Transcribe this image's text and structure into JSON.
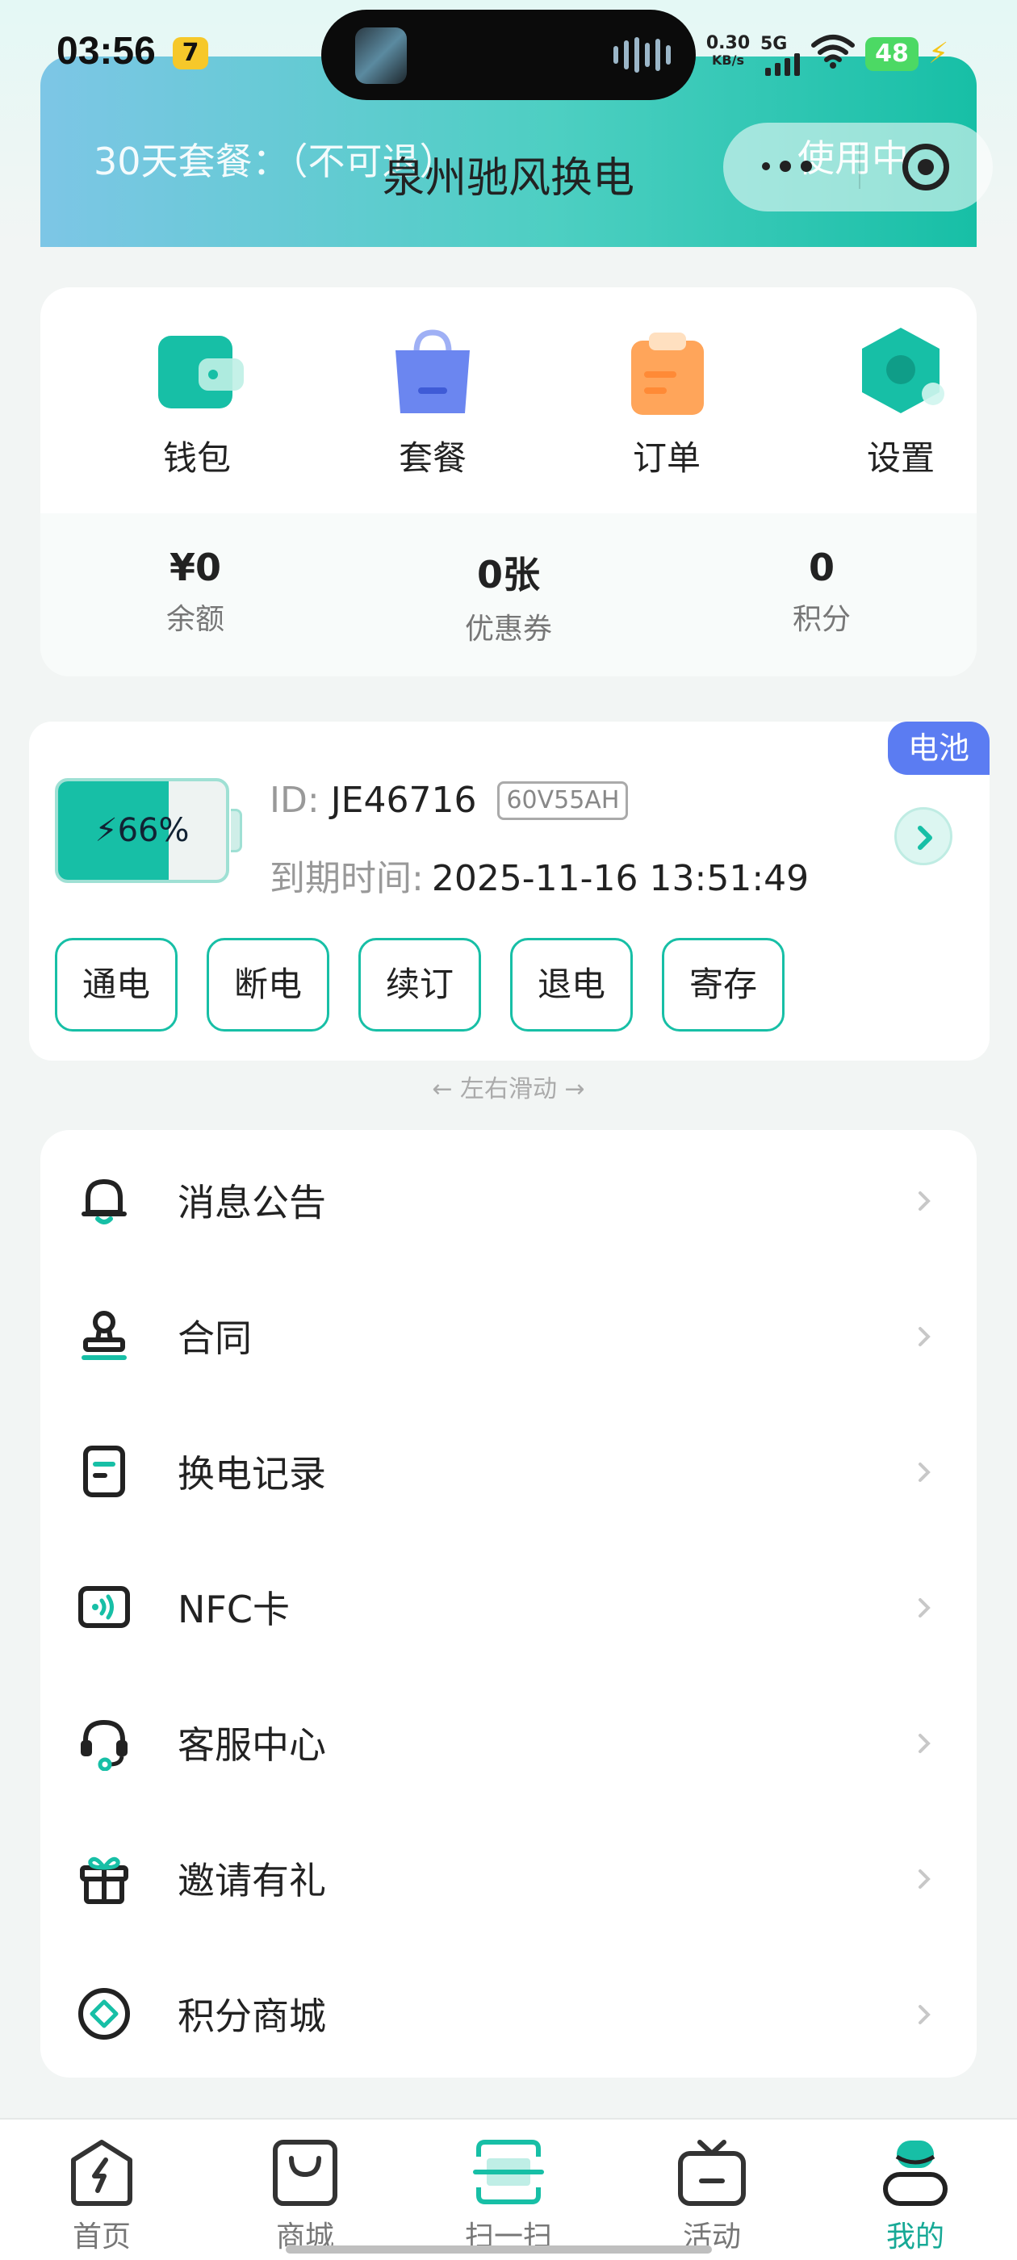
{
  "status_bar": {
    "time": "03:56",
    "badge": "7",
    "net_speed": "0.30",
    "net_unit": "KB/s",
    "network": "5G",
    "battery": "48"
  },
  "header": {
    "plan_text": "30天套餐：（不可退）",
    "title": "泉州驰风换电",
    "status": "使用中"
  },
  "quick_actions": [
    {
      "label": "钱包",
      "icon": "wallet-icon",
      "color": "#17bfa6"
    },
    {
      "label": "套餐",
      "icon": "bag-icon",
      "color": "#6b86f0"
    },
    {
      "label": "订单",
      "icon": "clipboard-icon",
      "color": "#ffa55a"
    },
    {
      "label": "设置",
      "icon": "hexagon-settings-icon",
      "color": "#17bfa6"
    }
  ],
  "stats": [
    {
      "value": "¥0",
      "label": "余额"
    },
    {
      "value": "0张",
      "label": "优惠券"
    },
    {
      "value": "0",
      "label": "积分"
    }
  ],
  "battery_card": {
    "tag": "电池",
    "level_text": "66%",
    "level_fraction": 0.66,
    "id_label": "ID:",
    "id_value": "JE46716",
    "spec": "60V55AH",
    "expire_label": "到期时间:",
    "expire_value": "2025-11-16 13:51:49",
    "buttons": [
      "通电",
      "断电",
      "续订",
      "退电",
      "寄存"
    ]
  },
  "swipe_hint": "← 左右滑动 →",
  "menu": [
    {
      "label": "消息公告",
      "icon": "bell-icon"
    },
    {
      "label": "合同",
      "icon": "stamp-icon"
    },
    {
      "label": "换电记录",
      "icon": "record-icon"
    },
    {
      "label": "NFC卡",
      "icon": "nfc-card-icon"
    },
    {
      "label": "客服中心",
      "icon": "headset-icon"
    },
    {
      "label": "邀请有礼",
      "icon": "gift-icon"
    },
    {
      "label": "积分商城",
      "icon": "points-store-icon"
    }
  ],
  "tabs": [
    {
      "label": "首页",
      "icon": "home-bolt-icon",
      "active": false
    },
    {
      "label": "商城",
      "icon": "shop-bag-icon",
      "active": false
    },
    {
      "label": "扫一扫",
      "icon": "scan-icon",
      "active": false
    },
    {
      "label": "活动",
      "icon": "tv-icon",
      "active": false
    },
    {
      "label": "我的",
      "icon": "profile-icon",
      "active": true
    }
  ],
  "colors": {
    "accent": "#17bfa6",
    "battery_tag": "#5b7cf2"
  }
}
